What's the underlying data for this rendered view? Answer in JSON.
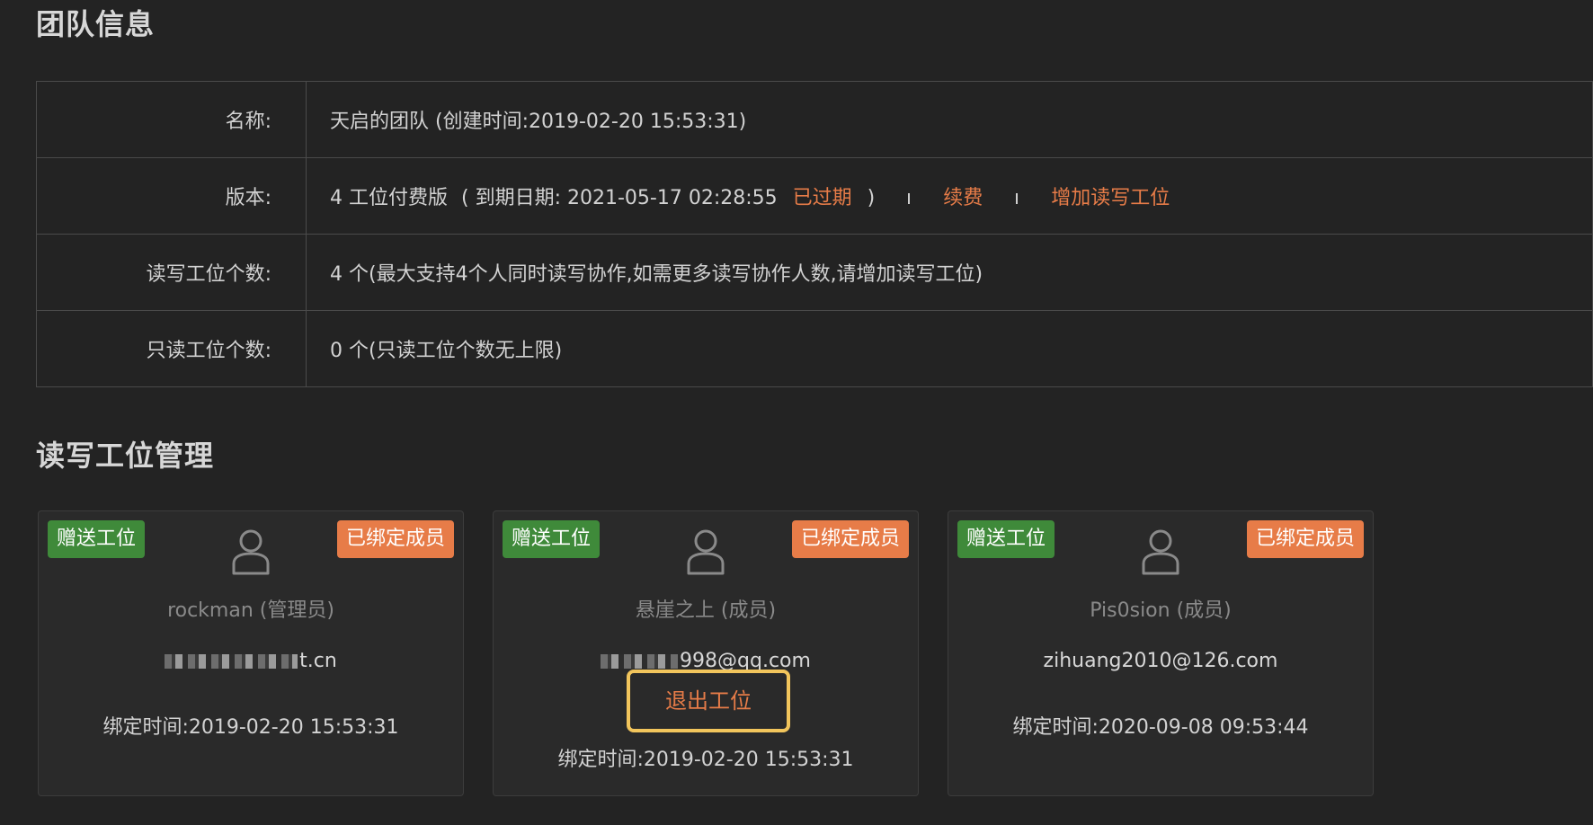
{
  "team_section": {
    "title": "团队信息",
    "rows": [
      {
        "label": "名称:",
        "value": "天启的团队 (创建时间:2019-02-20 15:53:31)"
      },
      {
        "label": "版本:",
        "plan": "4 工位付费版",
        "expiry_prefix": "( 到期日期: 2021-05-17 02:28:55",
        "status": "已过期",
        "close_paren": ")",
        "renew_link": "续费",
        "add_seat_link": "增加读写工位"
      },
      {
        "label": "读写工位个数:",
        "value": "4 个(最大支持4个人同时读写协作,如需更多读写协作人数,请增加读写工位)"
      },
      {
        "label": "只读工位个数:",
        "value": "0 个(只读工位个数无上限)"
      }
    ]
  },
  "seat_section": {
    "title": "读写工位管理",
    "cards": [
      {
        "gift_badge": "赠送工位",
        "bound_badge": "已绑定成员",
        "name": "rockman (管理员)",
        "email_visible": "t.cn",
        "bind_time": "绑定时间:2019-02-20 15:53:31"
      },
      {
        "gift_badge": "赠送工位",
        "bound_badge": "已绑定成员",
        "name": "悬崖之上 (成员)",
        "email_visible": "998@qq.com",
        "quit_button": "退出工位",
        "bind_time": "绑定时间:2019-02-20 15:53:31"
      },
      {
        "gift_badge": "赠送工位",
        "bound_badge": "已绑定成员",
        "name": "Pis0sion (成员)",
        "email": "zihuang2010@126.com",
        "bind_time": "绑定时间:2020-09-08 09:53:44"
      }
    ]
  },
  "colors": {
    "background": "#232323",
    "accent_orange": "#e77c48",
    "gift_green": "#3f8a3a",
    "highlight_yellow": "#f2c55c"
  },
  "icons": {
    "avatar": "user-avatar-icon"
  }
}
